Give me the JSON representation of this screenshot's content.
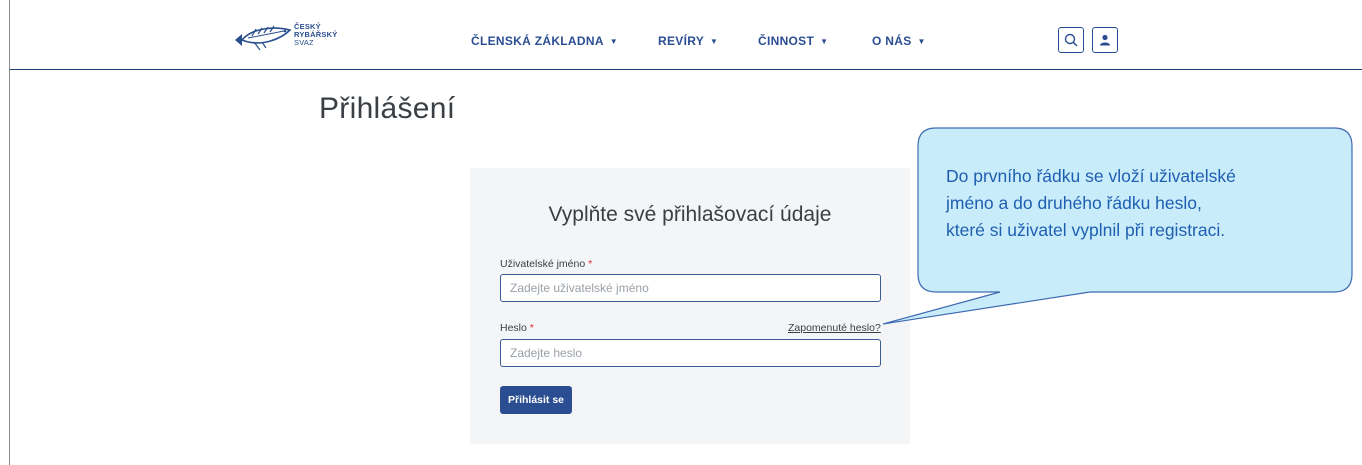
{
  "logo": {
    "line1": "ČESKÝ",
    "line2": "RYBÁŘSKÝ",
    "line3": "SVAZ",
    "icon": "fish-logo-icon"
  },
  "nav": {
    "items": [
      {
        "label": "ČLENSKÁ ZÁKLADNA"
      },
      {
        "label": "REVÍRY"
      },
      {
        "label": "ČINNOST"
      },
      {
        "label": "O NÁS"
      }
    ],
    "caret": "▼",
    "search_icon": "search-icon",
    "user_icon": "user-icon"
  },
  "page": {
    "title": "Přihlášení"
  },
  "form": {
    "heading": "Vyplňte své přihlašovací údaje",
    "username_label": "Uživatelské jméno",
    "username_placeholder": "Zadejte uživatelské jméno",
    "password_label": "Heslo",
    "password_placeholder": "Zadejte heslo",
    "required_mark": "*",
    "forgot_link": "Zapomenuté heslo?",
    "submit_label": "Přihlásit se"
  },
  "callout": {
    "lines": [
      "Do prvního řádku se vloží uživatelské",
      "jméno a do druhého řádku heslo,",
      "které si uživatel vyplnil při registraci."
    ]
  },
  "colors": {
    "brand": "#2b4e93",
    "callout_fill": "#c9ecfb",
    "callout_border": "#3e6bb0",
    "callout_text": "#1f5fb0",
    "required": "#d62b2b"
  }
}
